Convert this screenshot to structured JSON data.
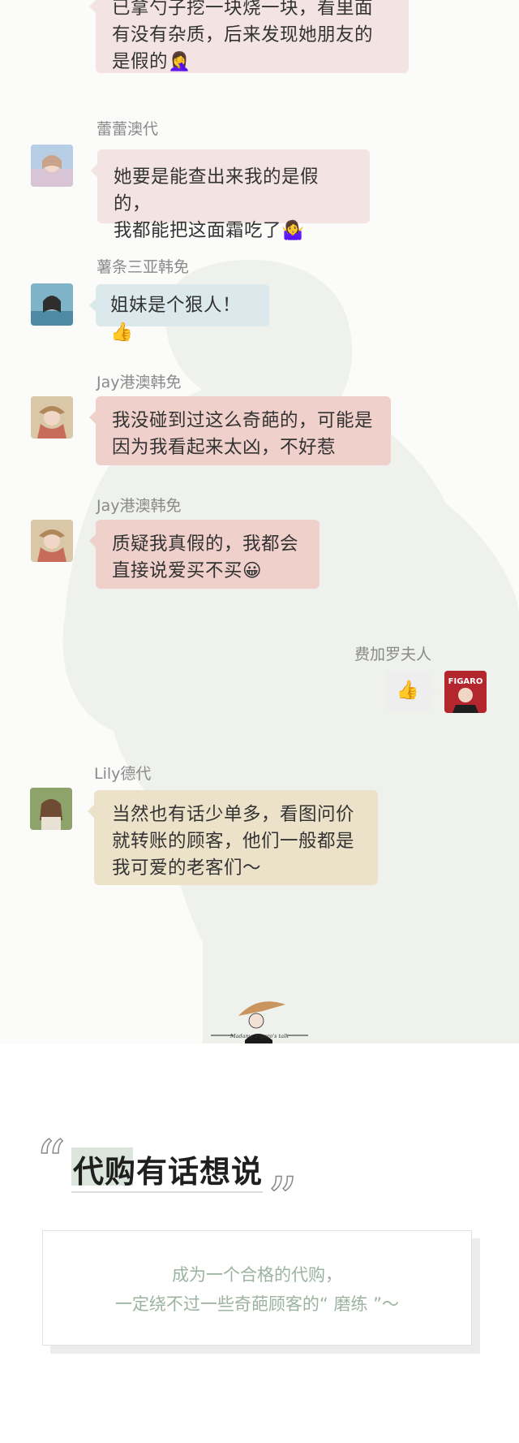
{
  "messages": [
    {
      "id": "m0",
      "sender": "",
      "text_lines": [
        "已拿勺子挖一块烧一块，看里面",
        "有没有杂质，后来发现她朋友的",
        "是假的🤦‍♀️"
      ]
    },
    {
      "id": "m1",
      "sender": "蕾蕾澳代",
      "text_lines": [
        "她要是能查出来我的是假的，",
        "我都能把这面霜吃了🤷‍♀️"
      ]
    },
    {
      "id": "m2",
      "sender": "薯条三亚韩免",
      "text_lines": [
        "姐妹是个狠人！👍"
      ]
    },
    {
      "id": "m3",
      "sender": "Jay港澳韩免",
      "text_lines": [
        "我没碰到过这么奇葩的，可能是",
        "因为我看起来太凶，不好惹"
      ]
    },
    {
      "id": "m4",
      "sender": "Jay港澳韩免",
      "text_lines": [
        "质疑我真假的，我都会",
        "直接说爱买不买😀"
      ]
    },
    {
      "id": "m5",
      "sender": "费加罗夫人",
      "text_lines": [
        "👍"
      ]
    },
    {
      "id": "m6",
      "sender": "Lily德代",
      "text_lines": [
        "当然也有话少单多，看图问价",
        "就转账的顾客，他们一般都是",
        "我可爱的老客们～"
      ]
    }
  ],
  "brand_tagline": "Madame Figaro's talk",
  "avatar_badge": "FIGARO",
  "section": {
    "heading": "代购有话想说",
    "quote_open": "“",
    "quote_close": "”",
    "card_lines": [
      "成为一个合格的代购，",
      "一定绕不过一些奇葩顾客的“ 磨练 ”～"
    ]
  },
  "colors": {
    "bubble_pink": "#f3e4e3",
    "bubble_blue": "#dbe9ec",
    "bubble_salmon": "#efd0cb",
    "bubble_beige": "#ece2c9",
    "card_text": "#9cb3a1",
    "heading_highlight": "#dbe5dc"
  }
}
